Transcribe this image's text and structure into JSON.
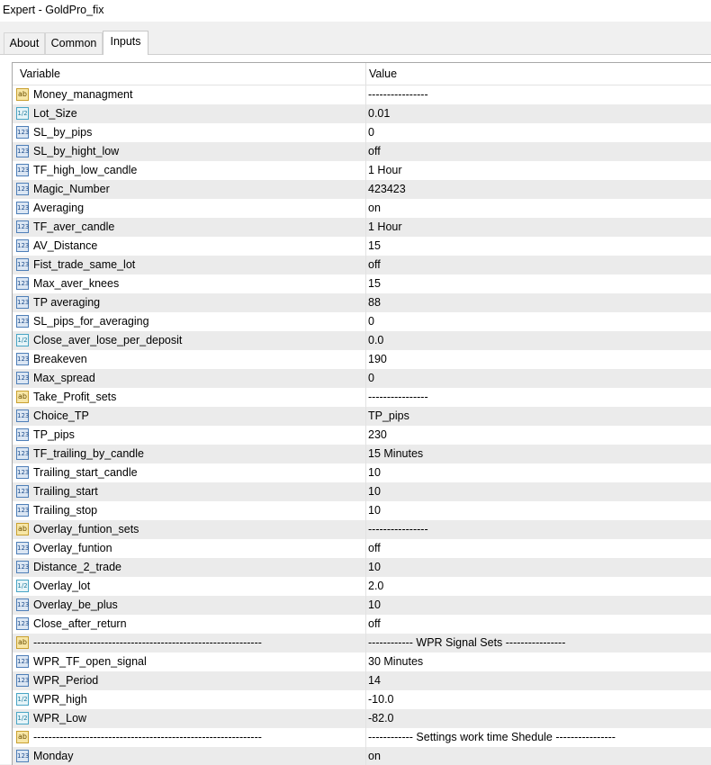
{
  "window": {
    "title": "Expert - GoldPro_fix"
  },
  "tabs": [
    {
      "label": "About",
      "active": false
    },
    {
      "label": "Common",
      "active": false
    },
    {
      "label": "Inputs",
      "active": true
    }
  ],
  "table": {
    "headers": {
      "variable": "Variable",
      "value": "Value"
    },
    "rows": [
      {
        "type": "string",
        "icon": "ab",
        "variable": "Money_managment",
        "value": "----------------"
      },
      {
        "type": "double",
        "icon": "1/2",
        "variable": "Lot_Size",
        "value": "0.01"
      },
      {
        "type": "int",
        "icon": "123",
        "variable": "SL_by_pips",
        "value": "0"
      },
      {
        "type": "int",
        "icon": "123",
        "variable": "SL_by_hight_low",
        "value": "off"
      },
      {
        "type": "int",
        "icon": "123",
        "variable": "TF_high_low_candle",
        "value": "1 Hour"
      },
      {
        "type": "int",
        "icon": "123",
        "variable": "Magic_Number",
        "value": "423423"
      },
      {
        "type": "int",
        "icon": "123",
        "variable": "Averaging",
        "value": "on"
      },
      {
        "type": "int",
        "icon": "123",
        "variable": "TF_aver_candle",
        "value": "1 Hour"
      },
      {
        "type": "int",
        "icon": "123",
        "variable": "AV_Distance",
        "value": "15"
      },
      {
        "type": "int",
        "icon": "123",
        "variable": "Fist_trade_same_lot",
        "value": "off"
      },
      {
        "type": "int",
        "icon": "123",
        "variable": "Max_aver_knees",
        "value": "15"
      },
      {
        "type": "int",
        "icon": "123",
        "variable": "TP averaging",
        "value": "88"
      },
      {
        "type": "int",
        "icon": "123",
        "variable": "SL_pips_for_averaging",
        "value": "0"
      },
      {
        "type": "double",
        "icon": "1/2",
        "variable": "Close_aver_lose_per_deposit",
        "value": "0.0"
      },
      {
        "type": "int",
        "icon": "123",
        "variable": "Breakeven",
        "value": "190"
      },
      {
        "type": "int",
        "icon": "123",
        "variable": "Max_spread",
        "value": "0"
      },
      {
        "type": "string",
        "icon": "ab",
        "variable": "Take_Profit_sets",
        "value": "----------------"
      },
      {
        "type": "int",
        "icon": "123",
        "variable": "Choice_TP",
        "value": "TP_pips"
      },
      {
        "type": "int",
        "icon": "123",
        "variable": "TP_pips",
        "value": "230"
      },
      {
        "type": "int",
        "icon": "123",
        "variable": "TF_trailing_by_candle",
        "value": "15 Minutes"
      },
      {
        "type": "int",
        "icon": "123",
        "variable": "Trailing_start_candle",
        "value": "10"
      },
      {
        "type": "int",
        "icon": "123",
        "variable": "Trailing_start",
        "value": "10"
      },
      {
        "type": "int",
        "icon": "123",
        "variable": "Trailing_stop",
        "value": "10"
      },
      {
        "type": "string",
        "icon": "ab",
        "variable": "Overlay_funtion_sets",
        "value": "----------------"
      },
      {
        "type": "int",
        "icon": "123",
        "variable": "Overlay_funtion",
        "value": "off"
      },
      {
        "type": "int",
        "icon": "123",
        "variable": "Distance_2_trade",
        "value": "10"
      },
      {
        "type": "double",
        "icon": "1/2",
        "variable": "Overlay_lot",
        "value": "2.0"
      },
      {
        "type": "int",
        "icon": "123",
        "variable": "Overlay_be_plus",
        "value": "10"
      },
      {
        "type": "int",
        "icon": "123",
        "variable": "Close_after_return",
        "value": "off"
      },
      {
        "type": "string",
        "icon": "ab",
        "variable": "-------------------------------------------------------------",
        "value": "------------ WPR Signal Sets ----------------"
      },
      {
        "type": "int",
        "icon": "123",
        "variable": "WPR_TF_open_signal",
        "value": "30 Minutes"
      },
      {
        "type": "int",
        "icon": "123",
        "variable": "WPR_Period",
        "value": "14"
      },
      {
        "type": "double",
        "icon": "1/2",
        "variable": "WPR_high",
        "value": "-10.0"
      },
      {
        "type": "double",
        "icon": "1/2",
        "variable": "WPR_Low",
        "value": "-82.0"
      },
      {
        "type": "string",
        "icon": "ab",
        "variable": "-------------------------------------------------------------",
        "value": "------------ Settings work time Shedule ----------------"
      },
      {
        "type": "int",
        "icon": "123",
        "variable": "Monday",
        "value": "on"
      }
    ]
  }
}
